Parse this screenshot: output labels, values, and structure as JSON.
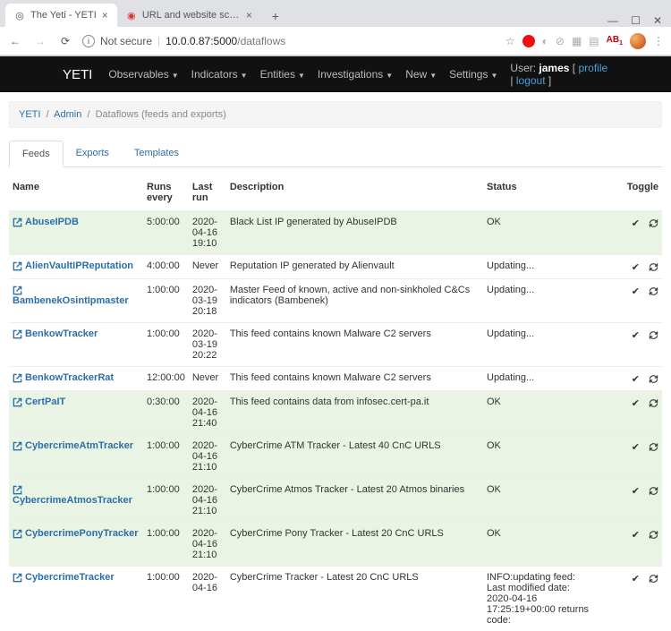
{
  "browser": {
    "tabs": [
      {
        "title": "The Yeti - YETI",
        "active": true
      },
      {
        "title": "URL and website scanner - urlsc",
        "active": false
      }
    ],
    "secure_label": "Not secure",
    "url_host": "10.0.0.87:5000",
    "url_path": "/dataflows"
  },
  "appbar": {
    "brand": "YETI",
    "items": [
      "Observables",
      "Indicators",
      "Entities",
      "Investigations",
      "New"
    ],
    "settings": "Settings",
    "user_label": "User:",
    "user_name": "james",
    "profile": "profile",
    "logout": "logout"
  },
  "crumbs": {
    "a": "YETI",
    "b": "Admin",
    "c": "Dataflows (feeds and exports)"
  },
  "tabs": {
    "feeds": "Feeds",
    "exports": "Exports",
    "templates": "Templates"
  },
  "table": {
    "headers": {
      "name": "Name",
      "runs": "Runs every",
      "last": "Last run",
      "desc": "Description",
      "status": "Status",
      "toggle": "Toggle"
    },
    "rows": [
      {
        "name": "AbuseIPDB",
        "runs": "5:00:00",
        "last": "2020-04-16 19:10",
        "desc": "Black List IP generated by AbuseIPDB",
        "status": "OK",
        "ok": true
      },
      {
        "name": "AlienVaultIPReputation",
        "runs": "4:00:00",
        "last": "Never",
        "desc": "Reputation IP generated by Alienvault",
        "status": "Updating...",
        "ok": false
      },
      {
        "name": "BambenekOsintIpmaster",
        "runs": "1:00:00",
        "last": "2020-03-19 20:18",
        "desc": "Master Feed of known, active and non-sinkholed C&Cs indicators (Bambenek)",
        "status": "Updating...",
        "ok": false
      },
      {
        "name": "BenkowTracker",
        "runs": "1:00:00",
        "last": "2020-03-19 20:22",
        "desc": "This feed contains known Malware C2 servers",
        "status": "Updating...",
        "ok": false
      },
      {
        "name": "BenkowTrackerRat",
        "runs": "12:00:00",
        "last": "Never",
        "desc": "This feed contains known Malware C2 servers",
        "status": "Updating...",
        "ok": false
      },
      {
        "name": "CertPaIT",
        "runs": "0:30:00",
        "last": "2020-04-16 21:40",
        "desc": "This feed contains data from infosec.cert-pa.it",
        "status": "OK",
        "ok": true
      },
      {
        "name": "CybercrimeAtmTracker",
        "runs": "1:00:00",
        "last": "2020-04-16 21:10",
        "desc": "CyberCrime ATM Tracker - Latest 40 CnC URLS",
        "status": "OK",
        "ok": true
      },
      {
        "name": "CybercrimeAtmosTracker",
        "runs": "1:00:00",
        "last": "2020-04-16 21:10",
        "desc": "CyberCrime Atmos Tracker - Latest 20 Atmos binaries",
        "status": "OK",
        "ok": true
      },
      {
        "name": "CybercrimePonyTracker",
        "runs": "1:00:00",
        "last": "2020-04-16 21:10",
        "desc": "CyberCrime Pony Tracker - Latest 20 CnC URLS",
        "status": "OK",
        "ok": true
      },
      {
        "name": "CybercrimeTracker",
        "runs": "1:00:00",
        "last": "2020-04-16",
        "desc": "CyberCrime Tracker - Latest 20 CnC URLS",
        "status": "INFO:updating feed: Last modified date: 2020-04-16 17:25:19+00:00 returns code:",
        "ok": false
      }
    ]
  }
}
